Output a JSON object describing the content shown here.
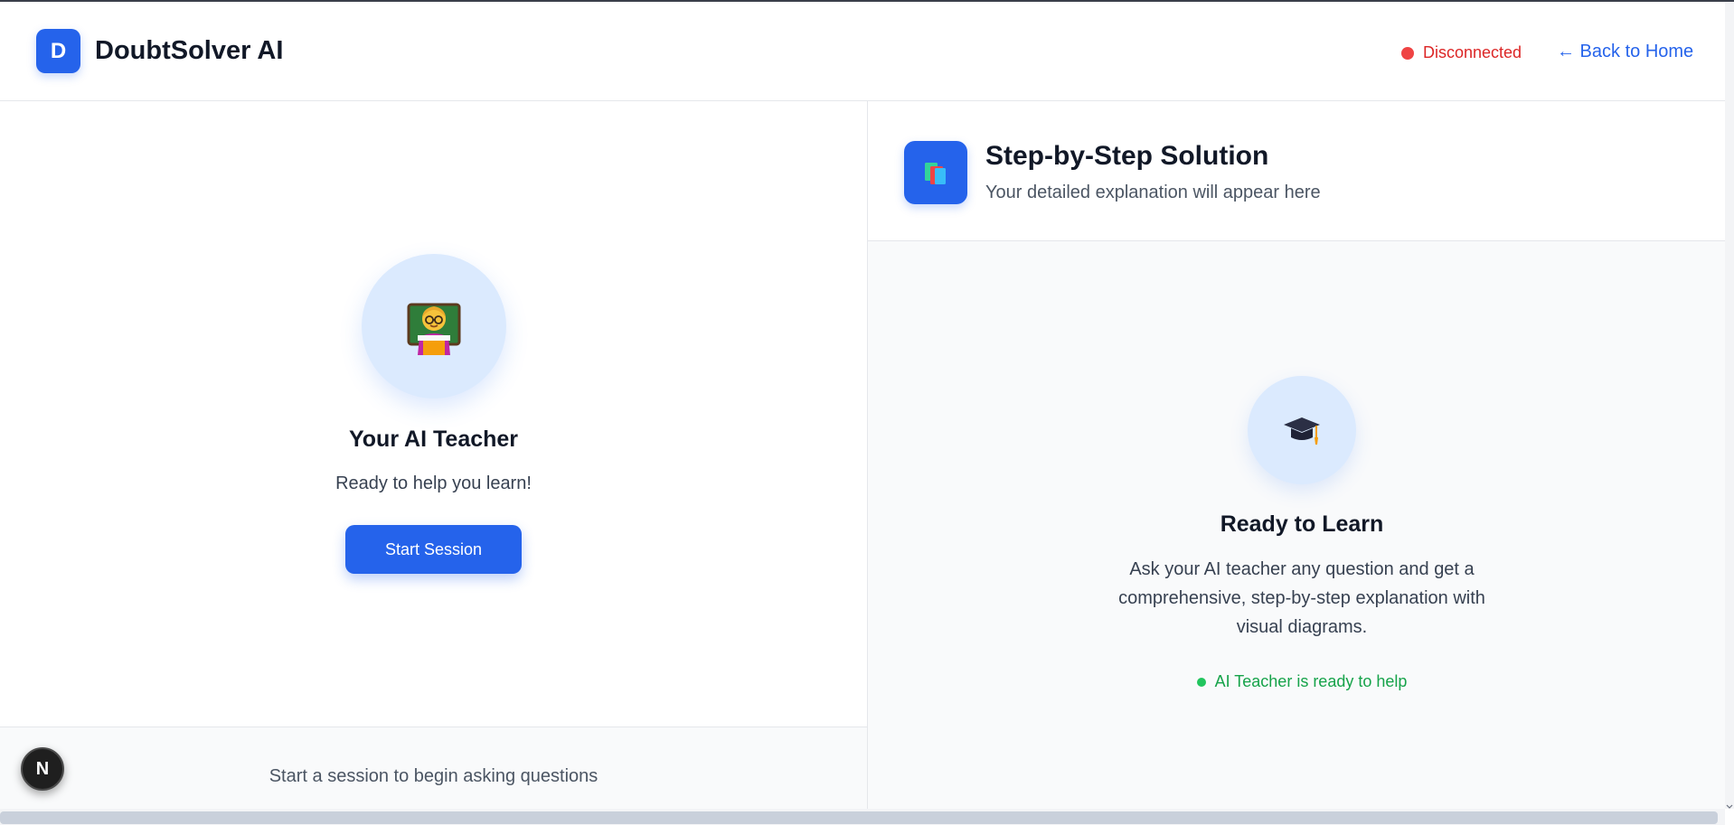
{
  "header": {
    "logo_letter": "D",
    "app_title": "DoubtSolver AI",
    "status_text": "Disconnected",
    "status_color": "#ef4444",
    "back_link": "← Back to Home"
  },
  "left": {
    "avatar_icon": "teacher-emoji-icon",
    "title": "Your AI Teacher",
    "subtitle": "Ready to help you learn!",
    "start_button": "Start Session",
    "footer_text": "Start a session to begin asking questions",
    "badge_letter": "N"
  },
  "right": {
    "header_icon": "books-icon",
    "title": "Step-by-Step Solution",
    "subtitle": "Your detailed explanation will appear here",
    "center_icon": "graduation-cap-icon",
    "ready_title": "Ready to Learn",
    "ready_description": "Ask your AI teacher any question and get a comprehensive, step-by-step explanation with visual diagrams.",
    "ready_status": "AI Teacher is ready to help",
    "ready_status_color": "#22c55e"
  },
  "colors": {
    "accent": "#2563eb",
    "light_accent": "#dbeafe"
  }
}
